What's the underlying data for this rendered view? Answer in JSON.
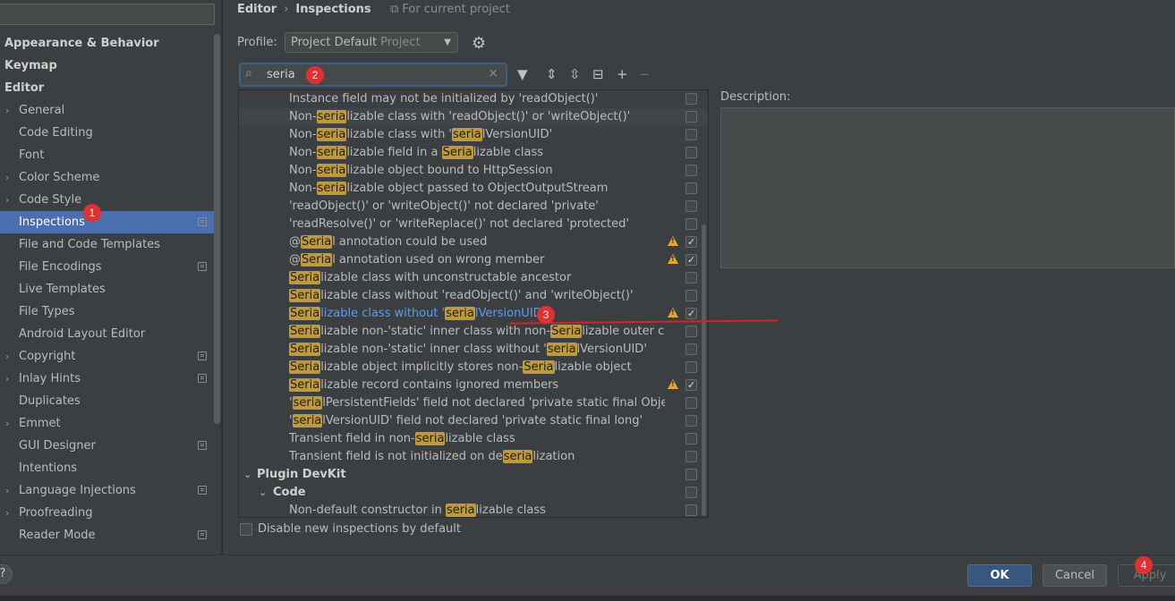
{
  "breadcrumb": {
    "section": "Editor",
    "page": "Inspections",
    "scope": "For current project"
  },
  "profile": {
    "label": "Profile:",
    "name": "Project Default",
    "scope": "Project"
  },
  "filter": {
    "value": "seria"
  },
  "sidebar": {
    "items": [
      {
        "label": "Appearance & Behavior",
        "kind": "top"
      },
      {
        "label": "Keymap",
        "kind": "top"
      },
      {
        "label": "Editor",
        "kind": "top"
      },
      {
        "label": "General",
        "expandable": true
      },
      {
        "label": "Code Editing"
      },
      {
        "label": "Font"
      },
      {
        "label": "Color Scheme",
        "expandable": true
      },
      {
        "label": "Code Style",
        "expandable": true
      },
      {
        "label": "Inspections",
        "selected": true,
        "project": true
      },
      {
        "label": "File and Code Templates"
      },
      {
        "label": "File Encodings",
        "project": true
      },
      {
        "label": "Live Templates"
      },
      {
        "label": "File Types"
      },
      {
        "label": "Android Layout Editor"
      },
      {
        "label": "Copyright",
        "expandable": true,
        "project": true
      },
      {
        "label": "Inlay Hints",
        "expandable": true,
        "project": true
      },
      {
        "label": "Duplicates"
      },
      {
        "label": "Emmet",
        "expandable": true
      },
      {
        "label": "GUI Designer",
        "project": true
      },
      {
        "label": "Intentions"
      },
      {
        "label": "Language Injections",
        "expandable": true,
        "project": true
      },
      {
        "label": "Proofreading",
        "expandable": true
      },
      {
        "label": "Reader Mode",
        "project": true
      }
    ]
  },
  "inspections": [
    {
      "text": "Instance field may not be initialized by 'readObject()'",
      "checked": false
    },
    {
      "text": "Non-[seria]lizable class with 'readObject()' or 'writeObject()'",
      "checked": false,
      "hover": true
    },
    {
      "text": "Non-[seria]lizable class with '[seria]lVersionUID'",
      "checked": false
    },
    {
      "text": "Non-[seria]lizable field in a [Seria]lizable class",
      "checked": false
    },
    {
      "text": "Non-[seria]lizable object bound to HttpSession",
      "checked": false
    },
    {
      "text": "Non-[seria]lizable object passed to ObjectOutputStream",
      "checked": false
    },
    {
      "text": "'readObject()' or 'writeObject()' not declared 'private'",
      "checked": false
    },
    {
      "text": "'readResolve()' or 'writeReplace()' not declared 'protected'",
      "checked": false
    },
    {
      "text": "@[Seria]l annotation could be used",
      "checked": true,
      "warn": true
    },
    {
      "text": "@[Seria]l annotation used on wrong member",
      "checked": true,
      "warn": true
    },
    {
      "text": "[Seria]lizable class with unconstructable ancestor",
      "checked": false
    },
    {
      "text": "[Seria]lizable class without 'readObject()' and 'writeObject()'",
      "checked": false
    },
    {
      "text": "[Seria]lizable class without '[seria]lVersionUID'",
      "checked": true,
      "warn": true,
      "link": true
    },
    {
      "text": "[Seria]lizable non-'static' inner class with non-[Seria]lizable outer class",
      "checked": false
    },
    {
      "text": "[Seria]lizable non-'static' inner class without '[seria]lVersionUID'",
      "checked": false
    },
    {
      "text": "[Seria]lizable object implicitly stores non-[Seria]lizable object",
      "checked": false
    },
    {
      "text": "[Seria]lizable record contains ignored members",
      "checked": true,
      "warn": true
    },
    {
      "text": "'[seria]lPersistentFields' field not declared 'private static final ObjectStrear",
      "checked": false
    },
    {
      "text": "'[seria]lVersionUID' field not declared 'private static final long'",
      "checked": false
    },
    {
      "text": "Transient field in non-[seria]lizable class",
      "checked": false
    },
    {
      "text": "Transient field is not initialized on de[seria]lization",
      "checked": false
    },
    {
      "text": "Plugin DevKit",
      "group": 1,
      "checked": false
    },
    {
      "text": "Code",
      "group": 2,
      "checked": false
    },
    {
      "text": "Non-default constructor in [seria]lizable class",
      "checked": false
    }
  ],
  "description": {
    "label": "Description:"
  },
  "disable_new": {
    "label": "Disable new inspections by default"
  },
  "footer": {
    "help": "?",
    "ok": "OK",
    "cancel": "Cancel",
    "apply": "Apply"
  },
  "badges": [
    "1",
    "2",
    "3",
    "4"
  ],
  "colors": {
    "selection": "#4b6eaf",
    "highlight": "#bf9a3a",
    "link": "#589df6",
    "warning": "#e5a82e",
    "ok_button": "#365880",
    "badge": "#e03030"
  }
}
